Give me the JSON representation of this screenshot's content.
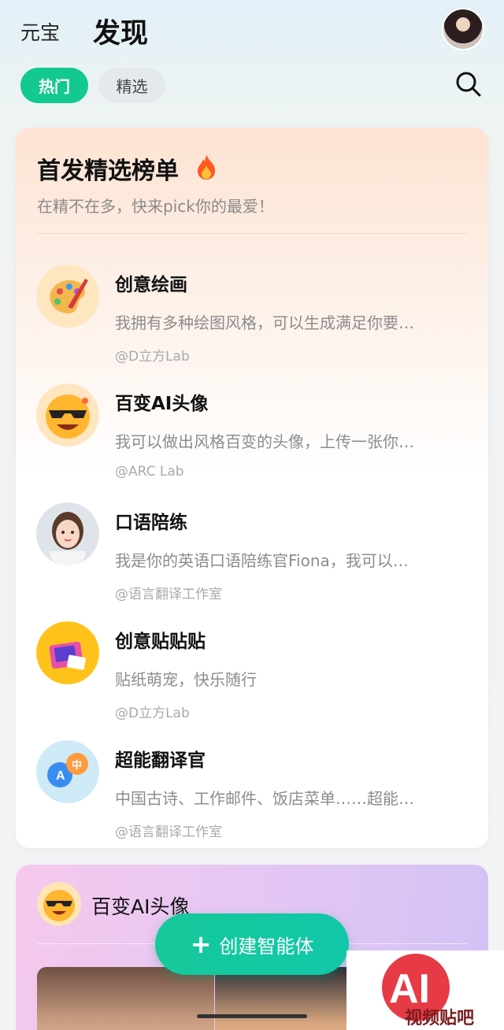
{
  "header": {
    "brand": "元宝",
    "title": "发现"
  },
  "tabs": [
    {
      "label": "热门",
      "active": true
    },
    {
      "label": "精选",
      "active": false
    }
  ],
  "ranking": {
    "title": "首发精选榜单",
    "subtitle": "在精不在多，快来pick你的最爱！",
    "items": [
      {
        "name": "创意绘画",
        "desc": "我拥有多种绘图风格，可以生成满足你要…",
        "author": "@D立方Lab",
        "icon": "palette-icon"
      },
      {
        "name": "百变AI头像",
        "desc": "我可以做出风格百变的头像，上传一张你…",
        "author": "@ARC Lab",
        "icon": "sunglasses-emoji-icon"
      },
      {
        "name": "口语陪练",
        "desc": "我是你的英语口语陪练官Fiona，我可以…",
        "author": "@语言翻译工作室",
        "icon": "tutor-avatar-icon"
      },
      {
        "name": "创意贴贴贴",
        "desc": "贴纸萌宠，快乐随行",
        "author": "@D立方Lab",
        "icon": "sticker-machine-icon"
      },
      {
        "name": "超能翻译官",
        "desc": "中国古诗、工作邮件、饭店菜单……超能…",
        "author": "@语言翻译工作室",
        "icon": "translate-bubbles-icon"
      }
    ]
  },
  "feature_card": {
    "title": "百变AI头像"
  },
  "fab": {
    "label": "创建智能体"
  },
  "watermark": {
    "logo": "AI",
    "text": "视频贴吧"
  },
  "colors": {
    "accent": "#12c98f"
  }
}
